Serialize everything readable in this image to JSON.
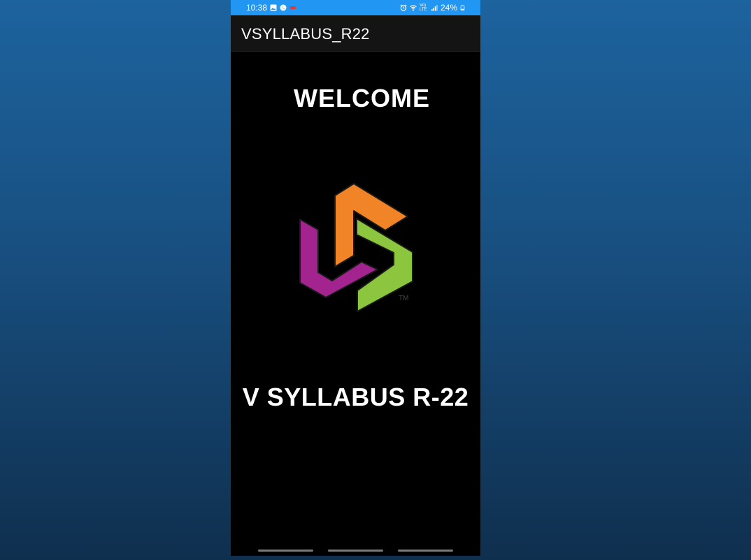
{
  "status_bar": {
    "time": "10:38",
    "battery": "24%",
    "network": "Vo) LTE",
    "left_icons": [
      "gallery-icon",
      "whatsapp-icon",
      "notification-icon"
    ],
    "right_icons": [
      "alarm-icon",
      "wifi-icon",
      "signal-icon",
      "battery-icon"
    ]
  },
  "app_bar": {
    "title": "VSYLLABUS_R22"
  },
  "main": {
    "welcome": "WELCOME",
    "logo_mark": "TM",
    "app_name": "V SYLLABUS R-22"
  },
  "colors": {
    "status_bar": "#2196f3",
    "app_bar": "#141414",
    "logo_orange": "#f08426",
    "logo_green": "#8cc63f",
    "logo_purple": "#a3248e"
  }
}
